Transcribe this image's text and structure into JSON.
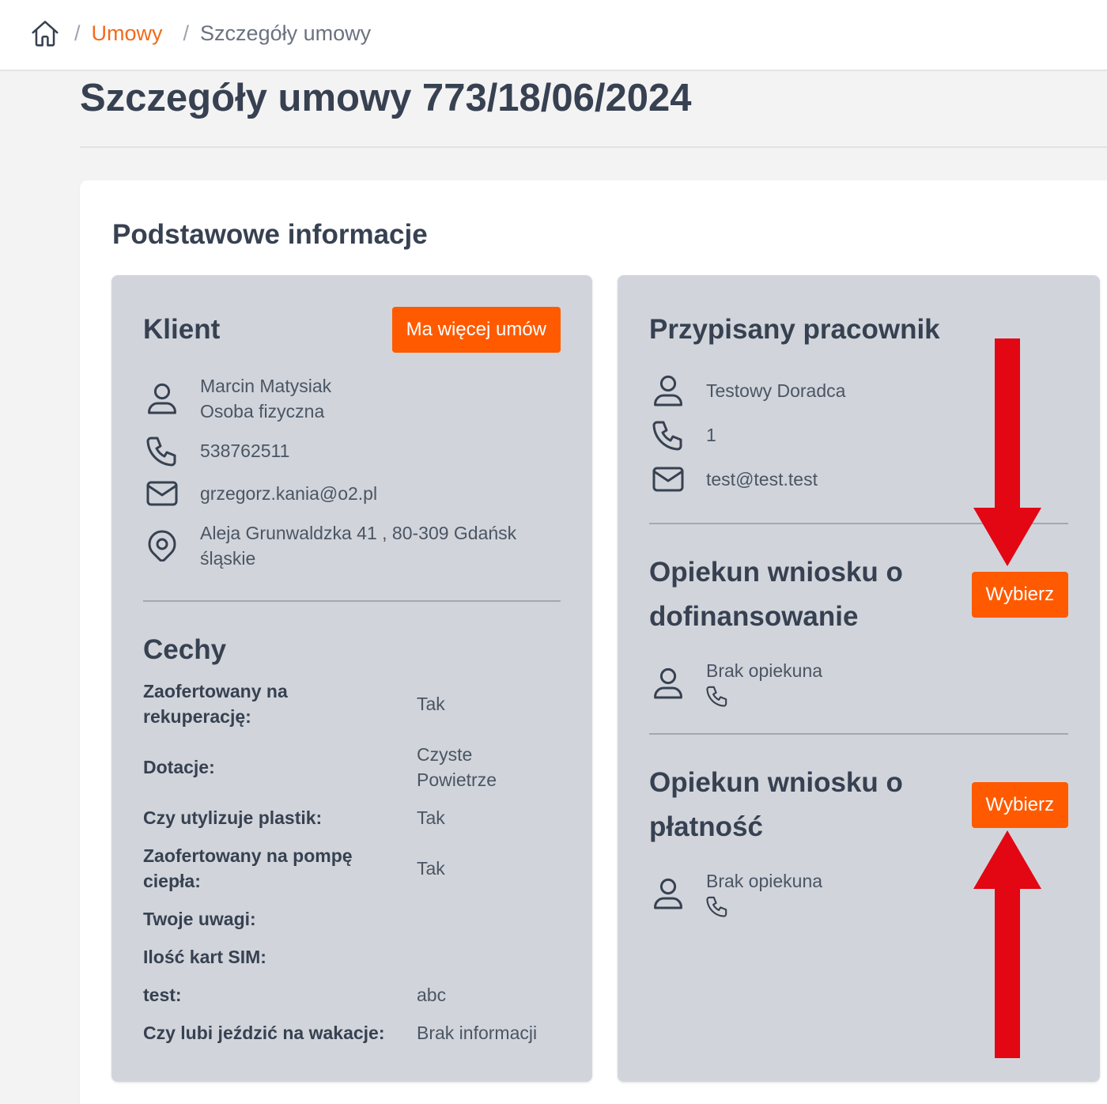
{
  "colors": {
    "accent": "#ff5a00",
    "link": "#f26a1b",
    "heading": "#374151",
    "text": "#4b5563",
    "panel": "#d1d5db",
    "page_bg": "#f3f3f3",
    "annotation": "#e30613"
  },
  "breadcrumb": {
    "home_icon": "home-icon",
    "separator": "/",
    "items": [
      {
        "label": "Umowy"
      },
      {
        "label": "Szczegóły umowy"
      }
    ]
  },
  "page": {
    "title": "Szczegóły umowy 773/18/06/2024"
  },
  "section": {
    "title": "Podstawowe informacje"
  },
  "client": {
    "title": "Klient",
    "more_contracts_button": "Ma więcej umów",
    "person_icon": "user-icon",
    "name": "Marcin Matysiak",
    "type": "Osoba fizyczna",
    "phone_icon": "phone-icon",
    "phone": "538762511",
    "email_icon": "mail-icon",
    "email": "grzegorz.kania@o2.pl",
    "address_icon": "map-pin-icon",
    "address_line1": "Aleja Grunwaldzka 41 , 80-309 Gdańsk",
    "address_line2": "śląskie"
  },
  "features": {
    "title": "Cechy",
    "rows": [
      {
        "label": "Zaofertowany na rekuperację:",
        "value": "Tak"
      },
      {
        "label": "Dotacje:",
        "value": "Czyste Powietrze"
      },
      {
        "label": "Czy utylizuje plastik:",
        "value": "Tak"
      },
      {
        "label": "Zaofertowany na pompę ciepła:",
        "value": "Tak"
      },
      {
        "label": "Twoje uwagi:",
        "value": ""
      },
      {
        "label": "Ilość kart SIM:",
        "value": ""
      },
      {
        "label": "test:",
        "value": "abc"
      },
      {
        "label": "Czy lubi jeździć na wakacje:",
        "value": "Brak informacji"
      }
    ]
  },
  "employee": {
    "title": "Przypisany pracownik",
    "person_icon": "user-icon",
    "name": "Testowy Doradca",
    "phone_icon": "phone-icon",
    "phone": "1",
    "email_icon": "mail-icon",
    "email": "test@test.test"
  },
  "grant_caretaker": {
    "title": "Opiekun wniosku o dofinansowanie",
    "select_button": "Wybierz",
    "person_icon": "user-icon",
    "name": "Brak opiekuna",
    "phone_icon": "phone-icon"
  },
  "payment_caretaker": {
    "title": "Opiekun wniosku o płatność",
    "select_button": "Wybierz",
    "person_icon": "user-icon",
    "name": "Brak opiekuna",
    "phone_icon": "phone-icon"
  }
}
